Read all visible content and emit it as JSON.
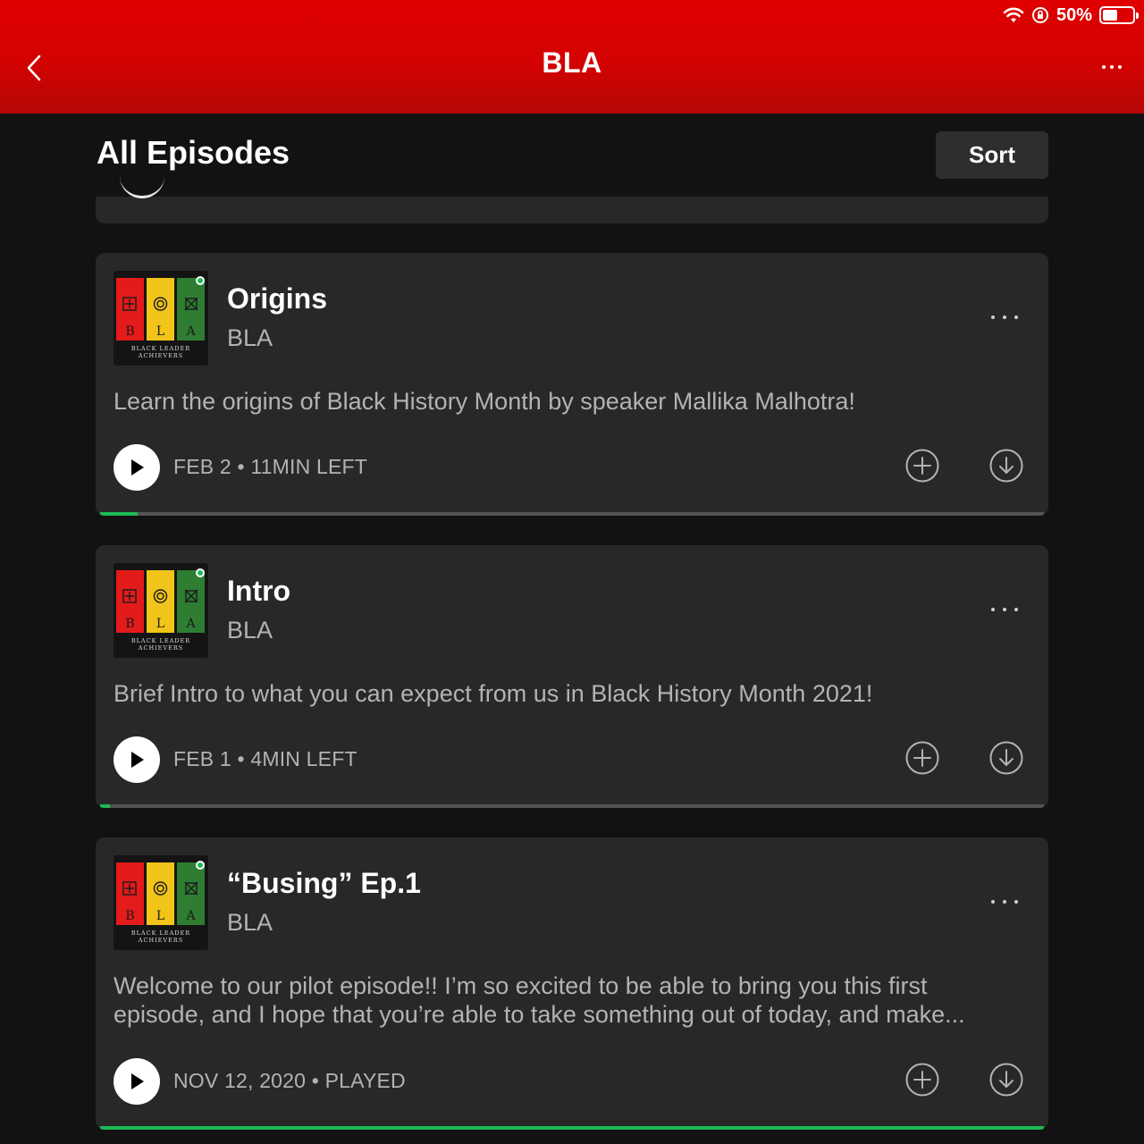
{
  "status_bar": {
    "battery_text": "50%",
    "battery_level": 0.5,
    "icons": [
      "wifi-icon",
      "orientation-lock-icon",
      "battery-icon"
    ]
  },
  "header": {
    "title": "BLA",
    "back_icon": "chevron-left-icon",
    "more_icon": "more-horizontal-icon"
  },
  "section": {
    "title": "All Episodes",
    "sort_label": "Sort"
  },
  "cover_art": {
    "letters": [
      "B",
      "L",
      "A"
    ],
    "caption_line1": "BLACK LEADER",
    "caption_line2": "ACHIEVERS"
  },
  "episodes": [
    {
      "title": "Origins",
      "show": "BLA",
      "description": "Learn the origins of Black History Month by speaker Mallika Malhotra!",
      "meta": "FEB 2 • 11MIN LEFT",
      "progress": 0.04
    },
    {
      "title": "Intro",
      "show": "BLA",
      "description": "Brief Intro to what you can expect from us in Black History Month 2021!",
      "meta": "FEB 1 • 4MIN LEFT",
      "progress": 0.01
    },
    {
      "title": "“Busing” Ep.1",
      "show": "BLA",
      "description": "Welcome to our pilot episode!! I’m so excited to be able to bring you this first episode, and I hope that you’re able to take something out of today, and make...",
      "meta": "NOV 12, 2020 • PLAYED",
      "progress": 1.0
    }
  ],
  "colors": {
    "header_red": "#e00000",
    "background": "#121212",
    "card": "#282828",
    "progress_green": "#1db954",
    "secondary_text": "#b3b3b3"
  }
}
